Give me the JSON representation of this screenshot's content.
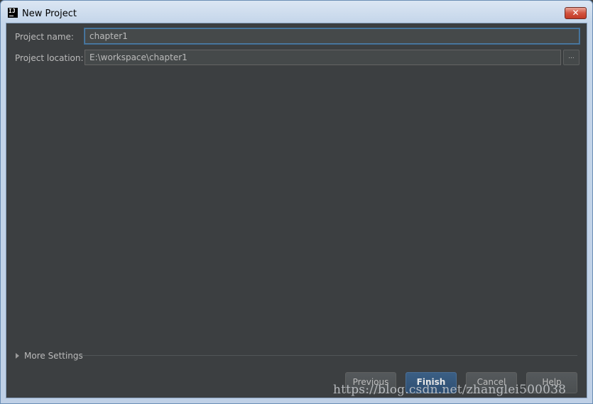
{
  "window": {
    "title": "New Project",
    "close_symbol": "✕"
  },
  "form": {
    "project_name": {
      "label": "Project name:",
      "value": "chapter1"
    },
    "project_location": {
      "label": "Project location:",
      "value": "E:\\workspace\\chapter1",
      "browse_label": "..."
    }
  },
  "more_settings": {
    "label": "More Settings"
  },
  "buttons": {
    "previous": "Previous",
    "finish": "Finish",
    "cancel": "Cancel",
    "help": "Help"
  },
  "watermark": "https://blog.csdn.net/zhanglei500038"
}
